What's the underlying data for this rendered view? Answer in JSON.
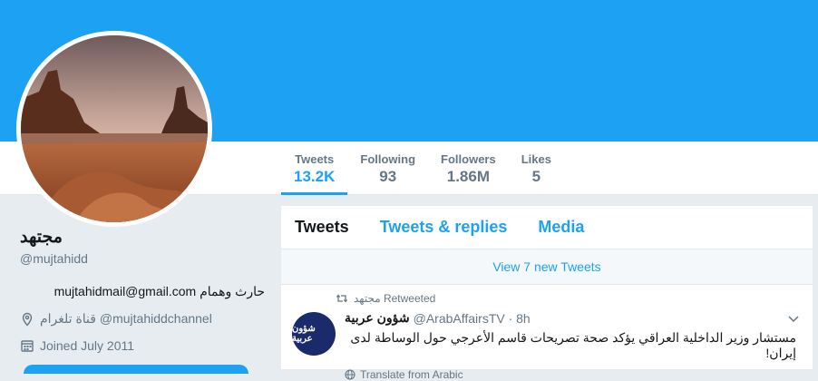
{
  "colors": {
    "brand": "#1da1f2",
    "text": "#14171a",
    "muted": "#657786",
    "background": "#e6ecf0"
  },
  "stats": [
    {
      "label": "Tweets",
      "value": "13.2K"
    },
    {
      "label": "Following",
      "value": "93"
    },
    {
      "label": "Followers",
      "value": "1.86M"
    },
    {
      "label": "Likes",
      "value": "5"
    }
  ],
  "profile": {
    "name": "مجتهد",
    "handle": "@mujtahidd",
    "bio": "حارث وهمام mujtahidmail@gmail.com",
    "location": "قناة تلغرام @mujtahiddchannel",
    "location_icon": "location-pin-icon",
    "joined": "Joined July 2011",
    "joined_icon": "calendar-icon"
  },
  "timeline": {
    "tabs": [
      {
        "label": "Tweets"
      },
      {
        "label": "Tweets & replies"
      },
      {
        "label": "Media"
      }
    ],
    "new_tweets": "View 7 new Tweets",
    "tweet": {
      "retweeted_by": "مجتهد Retweeted",
      "retweet_icon": "retweet-icon",
      "author_name": "شؤون عربية",
      "author_handle": "@ArabAffairsTV · 8h",
      "avatar_text": "شؤون عربية",
      "text": "مستشار وزير الداخلية العراقي يؤكد صحة تصريحات قاسم الأعرجي حول الوساطة لدى إيران!",
      "translate": "Translate from Arabic",
      "translate_icon": "globe-icon",
      "caret_icon": "chevron-down-icon"
    }
  }
}
